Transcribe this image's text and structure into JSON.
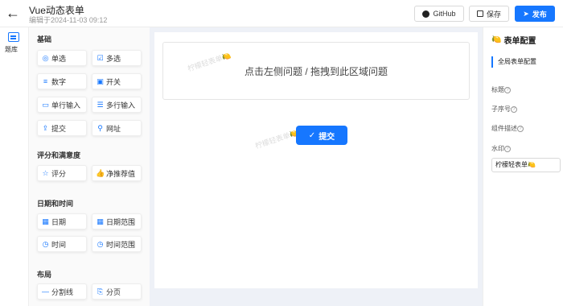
{
  "header": {
    "back_icon": "arrow-left-icon",
    "title": "Vue动态表单",
    "subtitle": "编辑于2024-11-03 09:12",
    "github_label": "GitHub",
    "save_label": "保存",
    "publish_label": "发布"
  },
  "left_tab": {
    "label": "题库"
  },
  "palette": {
    "basic_title": "基础",
    "basic_items": [
      "单选",
      "多选",
      "数字",
      "开关",
      "单行输入",
      "多行输入",
      "提交",
      "网址"
    ],
    "rating_title": "评分和满意度",
    "rating_items": [
      "评分",
      "净推荐值"
    ],
    "datetime_title": "日期和时间",
    "datetime_items": [
      "日期",
      "日期范围",
      "时间",
      "时间范围"
    ],
    "layout_title": "布局",
    "layout_items": [
      "分割线",
      "分页"
    ]
  },
  "canvas": {
    "dropzone_text": "点击左侧问题 / 拖拽到此区域问题",
    "watermark": "柠檬轻表单🍋",
    "submit_label": "提交"
  },
  "right_panel": {
    "title": "表单配置",
    "tab": "全局表单配置",
    "label_title": "标题",
    "label_serial": "子序号",
    "label_desc": "组件描述",
    "label_watermark": "水印",
    "watermark_value": "柠檬轻表单🍋"
  },
  "colors": {
    "accent": "#1677ff"
  }
}
